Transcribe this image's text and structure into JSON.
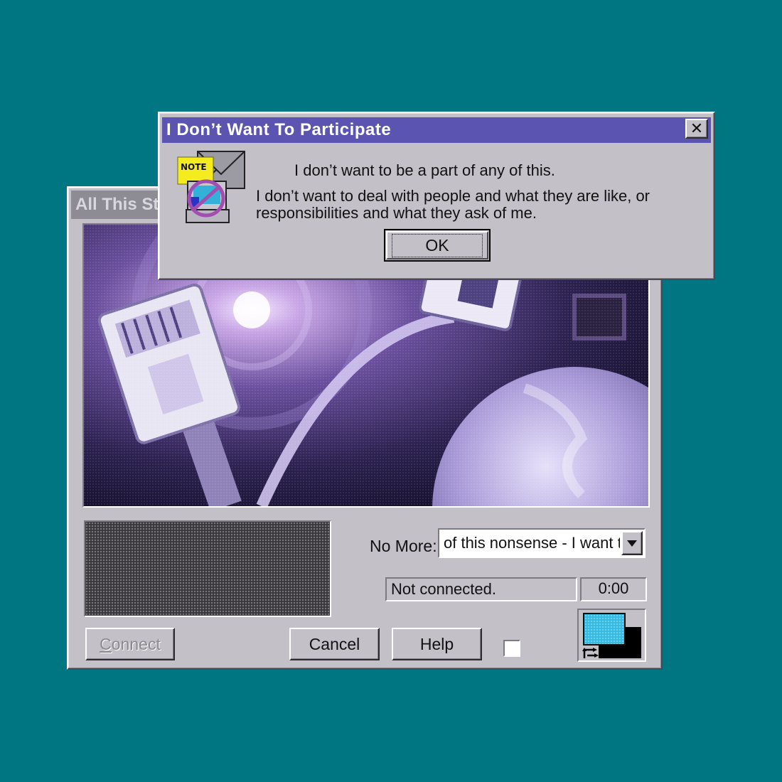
{
  "desktop": {
    "background_color": "#007683"
  },
  "back_window": {
    "title": "All This Stu",
    "no_more_label": "No More:",
    "no_more_value": "of this nonsense - I want t",
    "status_text": "Not connected.",
    "timer": "0:00",
    "connect_label_first": "C",
    "connect_label_rest": "onnect",
    "cancel_label": "Cancel",
    "help_label": "Help"
  },
  "dialog": {
    "title": "I Don’t Want To Participate",
    "icon_label": "NOTE",
    "line1": "I don’t want to be a part of any of this.",
    "line2": "I don’t want to deal with people and what they are like, or",
    "line3": "responsibilities and what they ask of me.",
    "ok_label": "OK",
    "close_symbol": "✕"
  },
  "colors": {
    "title_active": "#5b54b1",
    "title_inactive": "#8d8b93",
    "face": "#c3c0c8",
    "swatch_fg": "#38b9e0",
    "swatch_bg": "#000000"
  },
  "icons": {
    "dropdown": "triangle-down-icon",
    "close": "close-icon",
    "note": "note-fax-icon",
    "swap": "swap-arrows-icon"
  }
}
